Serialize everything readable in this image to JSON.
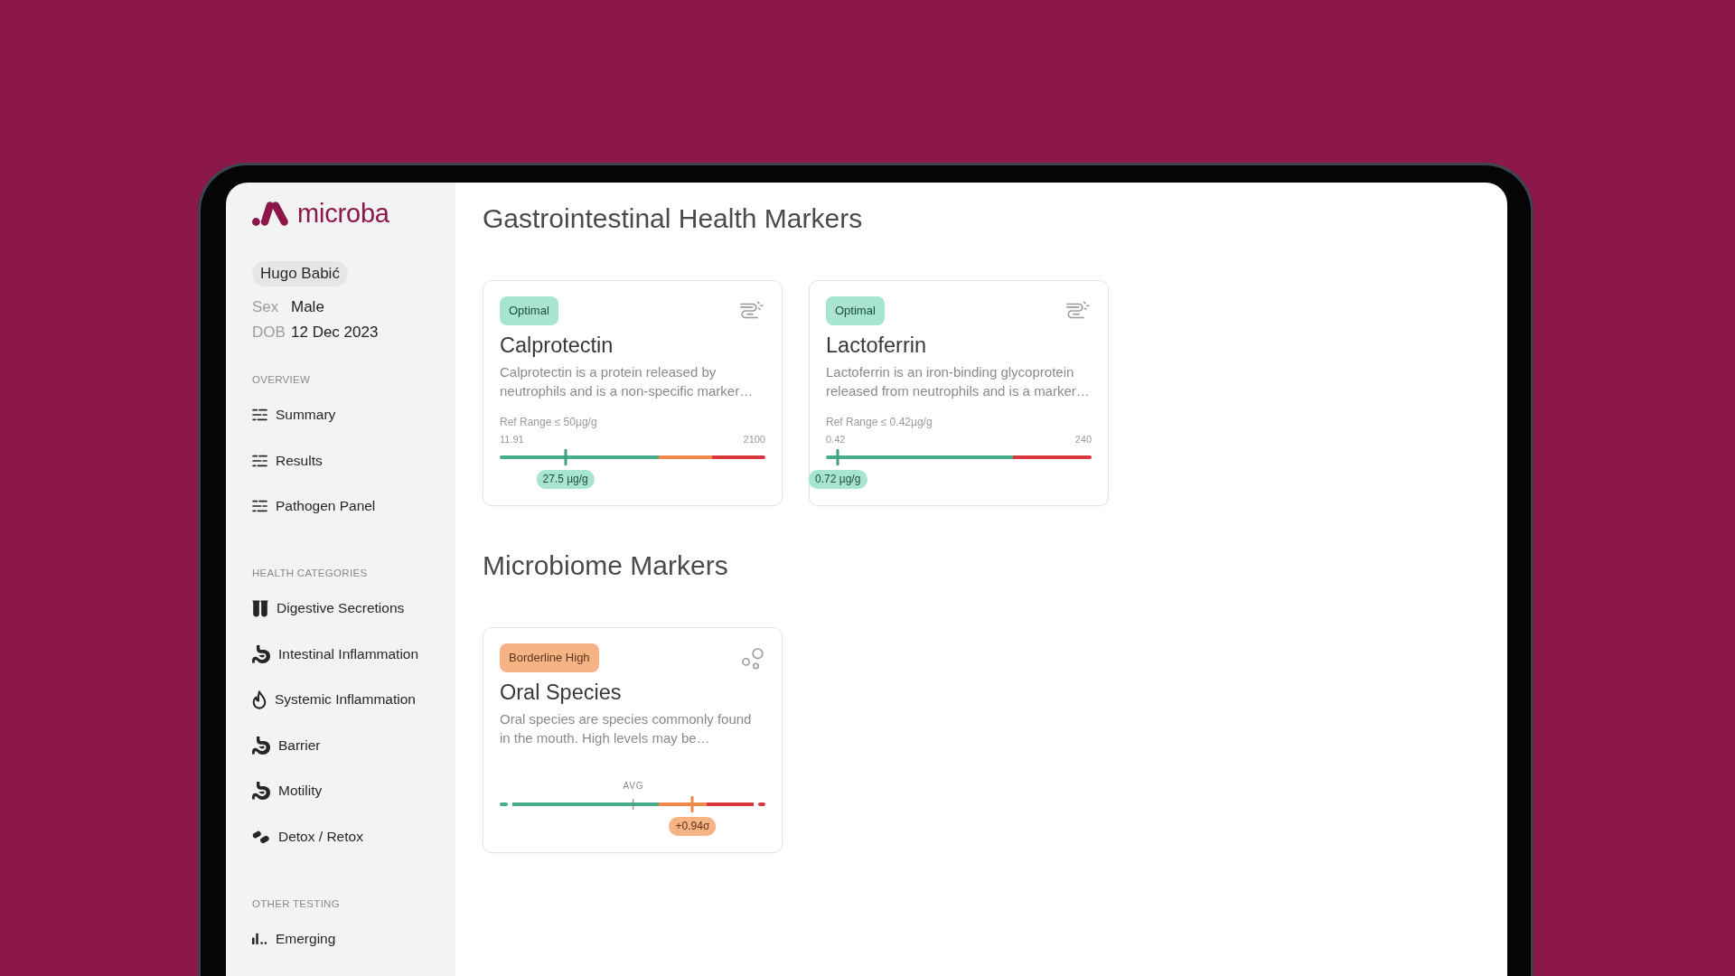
{
  "app": {
    "brand": "microba"
  },
  "sidebar": {
    "patient": {
      "name": "Hugo Babić",
      "fields": [
        {
          "label": "Sex",
          "value": "Male"
        },
        {
          "label": "DOB",
          "value": "12 Dec 2023"
        }
      ]
    },
    "groups": [
      {
        "title": "OVERVIEW",
        "items": [
          {
            "label": "Summary",
            "kind": "list",
            "selected": false
          },
          {
            "label": "Results",
            "kind": "list",
            "selected": false
          },
          {
            "label": "Pathogen Panel",
            "kind": "list",
            "selected": false
          }
        ]
      },
      {
        "title": "HEALTH CATEGORIES",
        "items": [
          {
            "label": "Digestive Secretions",
            "kind": "tubes",
            "selected": false
          },
          {
            "label": "Intestinal Inflammation",
            "kind": "stomach",
            "selected": false
          },
          {
            "label": "Systemic Inflammation",
            "kind": "flame",
            "selected": false
          },
          {
            "label": "Barrier",
            "kind": "stomach",
            "selected": false
          },
          {
            "label": "Motility",
            "kind": "stomach",
            "selected": false
          },
          {
            "label": "Detox / Retox",
            "kind": "pills",
            "selected": false
          }
        ]
      },
      {
        "title": "OTHER TESTING",
        "items": [
          {
            "label": "Emerging",
            "kind": "bars",
            "selected": false
          }
        ]
      }
    ]
  },
  "sections": [
    {
      "title": "Gastrointestinal Health Markers",
      "cards": [
        {
          "badge": {
            "label": "Optimal",
            "kind": "optimal"
          },
          "kind": "gut",
          "title": "Calprotectin",
          "description": "Calprotectin is a protein released by neutrophils and is a non-specific marker…",
          "gauge": {
            "kind": "three_zone",
            "ref_range": "Ref Range ≤ 50µg/g",
            "min": "11.91",
            "max": "2100",
            "marker": {
              "level": 0.247,
              "reading": "27.5 µg/g"
            }
          }
        },
        {
          "badge": {
            "label": "Optimal",
            "kind": "optimal"
          },
          "kind": "gut",
          "title": "Lactoferrin",
          "description": "Lactoferrin is an iron-binding glycoprotein released from neutrophils and is a marker…",
          "gauge": {
            "kind": "two_zone",
            "ref_range": "Ref Range ≤ 0.42µg/g",
            "min": "0.42",
            "max": "240",
            "marker": {
              "level": 0.045,
              "reading": "0.72 µg/g"
            }
          }
        }
      ]
    },
    {
      "title": "Microbiome Markers",
      "cards": [
        {
          "badge": {
            "label": "Borderline High",
            "kind": "borderline"
          },
          "kind": "oral",
          "title": "Oral Species",
          "description": "Oral species are species commonly found in the mouth. High levels may be…",
          "gauge": {
            "kind": "sigma",
            "avg": {
              "label": "AVG",
              "level": 0.503
            },
            "marker": {
              "level": 0.726,
              "reading": "+0.94σ"
            }
          }
        }
      ]
    }
  ]
}
